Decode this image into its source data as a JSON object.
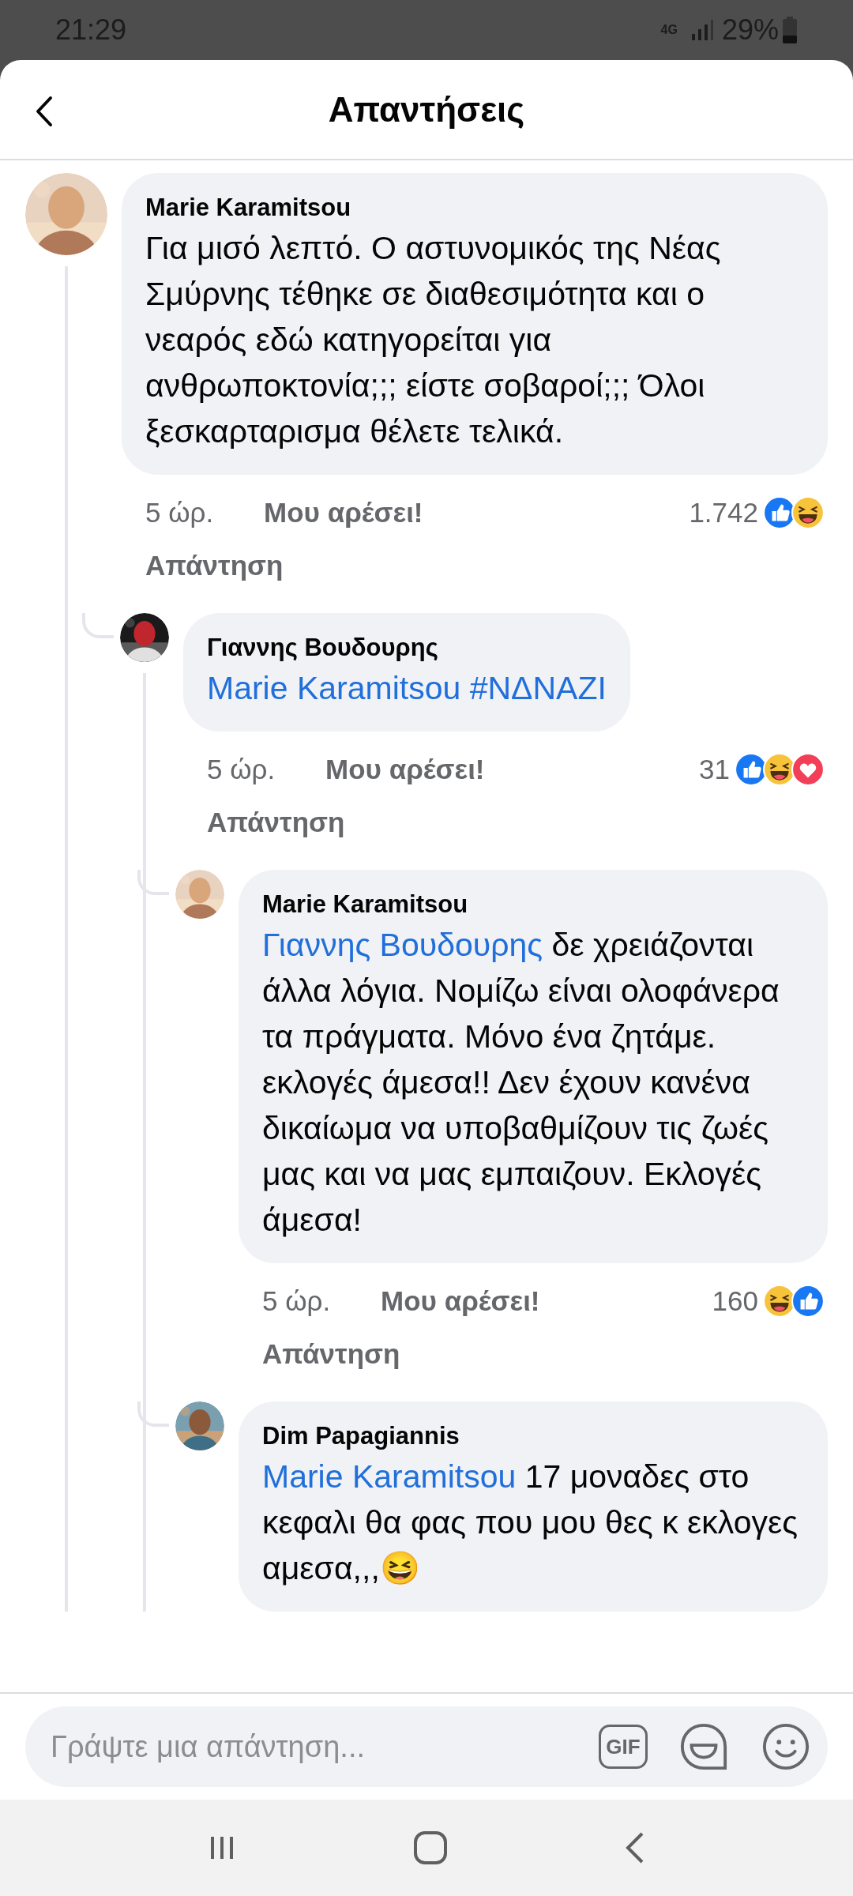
{
  "status_bar": {
    "time": "21:29",
    "network": "4G",
    "battery": "29%"
  },
  "header": {
    "title": "Απαντήσεις"
  },
  "comments": [
    {
      "author": "Marie Karamitsou",
      "body": [
        {
          "kind": "text",
          "text": "Για μισό λεπτό. Ο αστυνομικός της Νέας Σμύρνης τέθηκε σε διαθεσιμότητα και ο νεαρός εδώ κατηγορείται για ανθρωποκτονία;;; είστε σοβαροί;;; Όλοι ξεσκαρταρισμα θέλετε τελικά."
        }
      ],
      "time": "5 ώρ.",
      "like": "Μου αρέσει!",
      "reply": "Απάντηση",
      "reaction_count": "1.742",
      "reactions": [
        {
          "kind": "like"
        },
        {
          "kind": "haha"
        }
      ],
      "children": [
        {
          "author": "Γιαννης Βουδουρης",
          "body": [
            {
              "kind": "mention",
              "text": "Marie Karamitsou"
            },
            {
              "kind": "mention",
              "text": "#ΝΔΝΑΖΙ"
            }
          ],
          "time": "5 ώρ.",
          "like": "Μου αρέσει!",
          "reply": "Απάντηση",
          "reaction_count": "31",
          "reactions": [
            {
              "kind": "like"
            },
            {
              "kind": "haha"
            },
            {
              "kind": "love"
            }
          ],
          "children": [
            {
              "author": "Marie Karamitsou",
              "body": [
                {
                  "kind": "mention",
                  "text": "Γιαννης Βουδουρης"
                },
                {
                  "kind": "text",
                  "text": "δε χρειάζονται άλλα λόγια. Νομίζω είναι ολοφάνερα τα πράγματα. Μόνο ένα ζητάμε. εκλογές άμεσα!! Δεν έχουν κανένα δικαίωμα να υποβαθμίζουν τις ζωές μας και να μας εμπαιζουν. Εκλογές άμεσα!"
                }
              ],
              "time": "5 ώρ.",
              "like": "Μου αρέσει!",
              "reply": "Απάντηση",
              "reaction_count": "160",
              "reactions": [
                {
                  "kind": "haha"
                },
                {
                  "kind": "like"
                }
              ]
            },
            {
              "author": "Dim Papagiannis",
              "body": [
                {
                  "kind": "mention",
                  "text": "Marie Karamitsou"
                },
                {
                  "kind": "text",
                  "text": "17 μοναδες στο κεφαλι θα φας που μου θες κ εκλογες αμεσα,,,😆"
                }
              ]
            }
          ]
        }
      ]
    }
  ],
  "composer": {
    "placeholder": "Γράψτε μια απάντηση...",
    "gif": "GIF"
  }
}
